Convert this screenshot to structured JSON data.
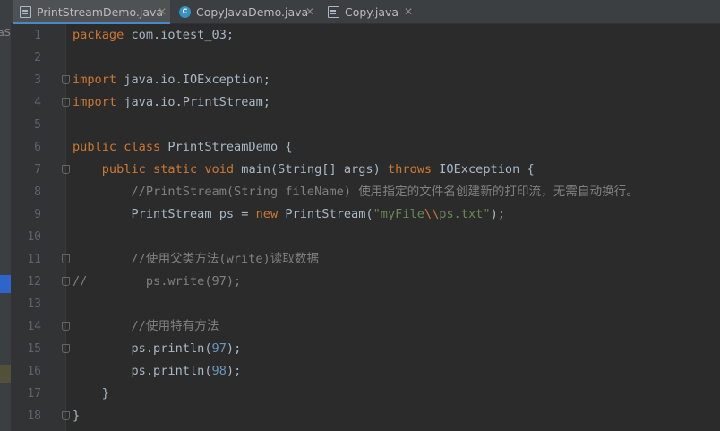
{
  "tabs": [
    {
      "label": "PrintStreamDemo.java",
      "icon": "java-file-icon",
      "active": true
    },
    {
      "label": "CopyJavaDemo.java",
      "icon": "java-class-icon",
      "active": false
    },
    {
      "label": "Copy.java",
      "icon": "java-file-icon",
      "active": false
    }
  ],
  "project_strip": {
    "clipped_text": "aS"
  },
  "colors": {
    "keyword": "#cc7832",
    "comment": "#808080",
    "string": "#6a8759",
    "number": "#6897bb",
    "text": "#a9b7c6",
    "background": "#2b2b2b",
    "gutter": "#313335"
  },
  "editor": {
    "line_numbers": [
      "1",
      "2",
      "3",
      "4",
      "5",
      "6",
      "7",
      "8",
      "9",
      "10",
      "11",
      "12",
      "13",
      "14",
      "15",
      "16",
      "17",
      "18"
    ],
    "lines": {
      "l1": {
        "kw": "package",
        "rest": " com.iotest_03;"
      },
      "l3": {
        "kw": "import",
        "rest": " java.io.IOException;"
      },
      "l4": {
        "kw": "import",
        "rest": " java.io.PrintStream;"
      },
      "l6": {
        "kw": "public class",
        "rest": " PrintStreamDemo {"
      },
      "l7": {
        "indent": "    ",
        "kw": "public static void",
        "mid": " main(String[] args) ",
        "kw2": "throws",
        "rest": " IOException {"
      },
      "l8": {
        "indent": "        ",
        "comment": "//PrintStream(String fileName) 使用指定的文件名创建新的打印流，无需自动换行。"
      },
      "l9": {
        "indent": "        ",
        "pre": "PrintStream ps = ",
        "kw": "new",
        "mid": " PrintStream(",
        "str1": "\"myFile",
        "esc": "\\\\",
        "str2": "ps.txt\"",
        "rest": ");"
      },
      "l11": {
        "indent": "        ",
        "comment": "//使用父类方法(write)读取数据"
      },
      "l12": {
        "comment": "//        ps.write(97);"
      },
      "l14": {
        "indent": "        ",
        "comment": "//使用特有方法"
      },
      "l15": {
        "indent": "        ",
        "pre": "ps.println(",
        "num": "97",
        "rest": ");"
      },
      "l16": {
        "indent": "        ",
        "pre": "ps.println(",
        "num": "98",
        "rest": ");"
      },
      "l17": {
        "indent": "    ",
        "rest": "}"
      },
      "l18": {
        "rest": "}"
      }
    }
  }
}
